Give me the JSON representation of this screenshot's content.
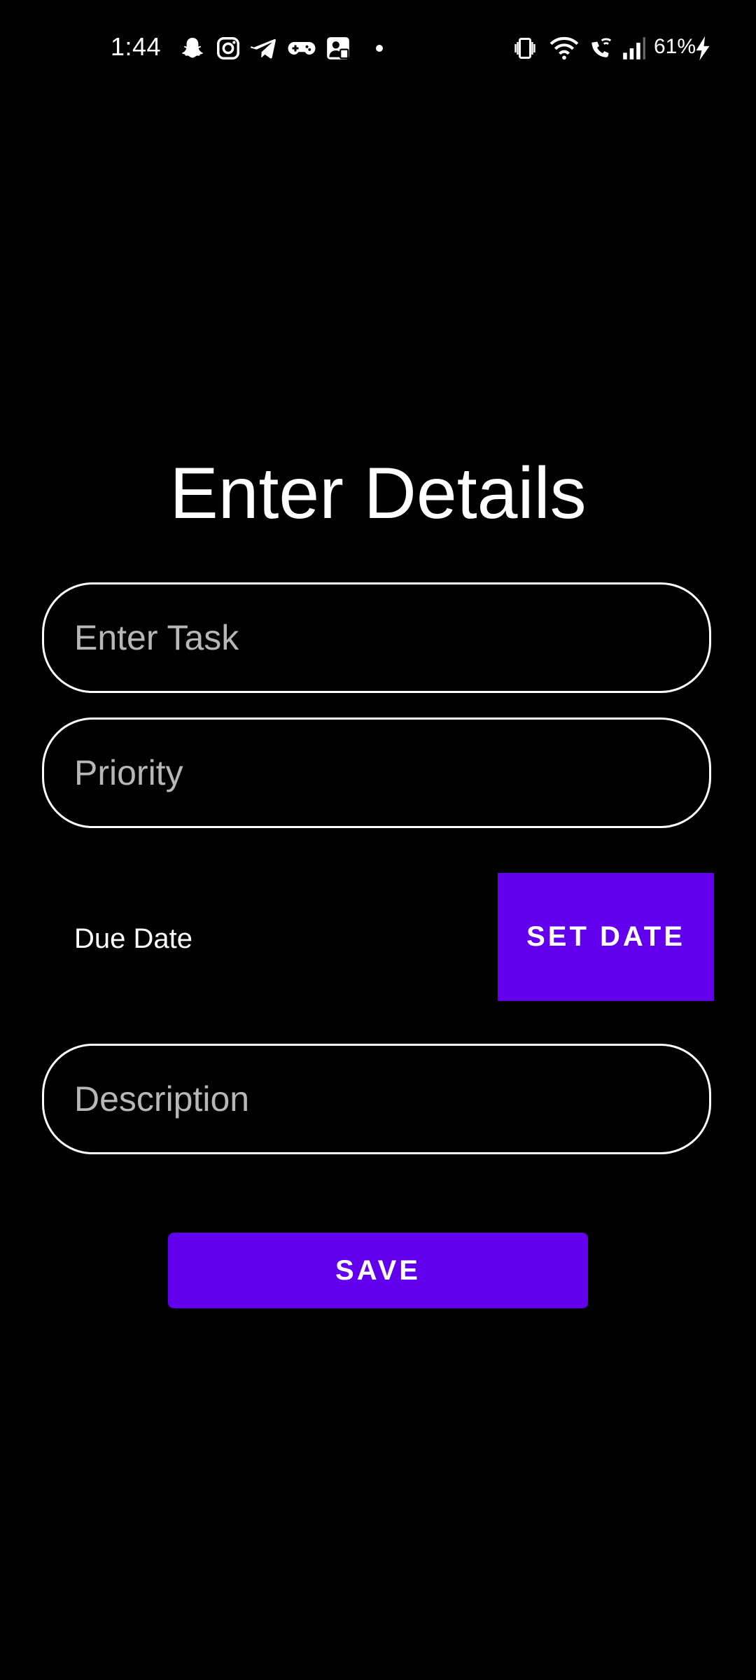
{
  "status_bar": {
    "time": "1:44",
    "battery": "61%",
    "notification_icons": [
      "snapchat-icon",
      "instagram-icon",
      "telegram-icon",
      "gamepad-icon",
      "badge-app-icon",
      "dot-icon"
    ],
    "system_icons": [
      "vibrate-icon",
      "wifi-icon",
      "wifi-calling-icon",
      "signal-icon",
      "charging-icon"
    ]
  },
  "form": {
    "title": "Enter Details",
    "task_placeholder": "Enter Task",
    "priority_placeholder": "Priority",
    "due_date_label": "Due Date",
    "set_date_label": "SET DATE",
    "description_placeholder": "Description",
    "save_label": "SAVE"
  },
  "colors": {
    "background": "#000000",
    "accent": "#6200ee",
    "text": "#ffffff",
    "placeholder": "#b7b7b7"
  }
}
